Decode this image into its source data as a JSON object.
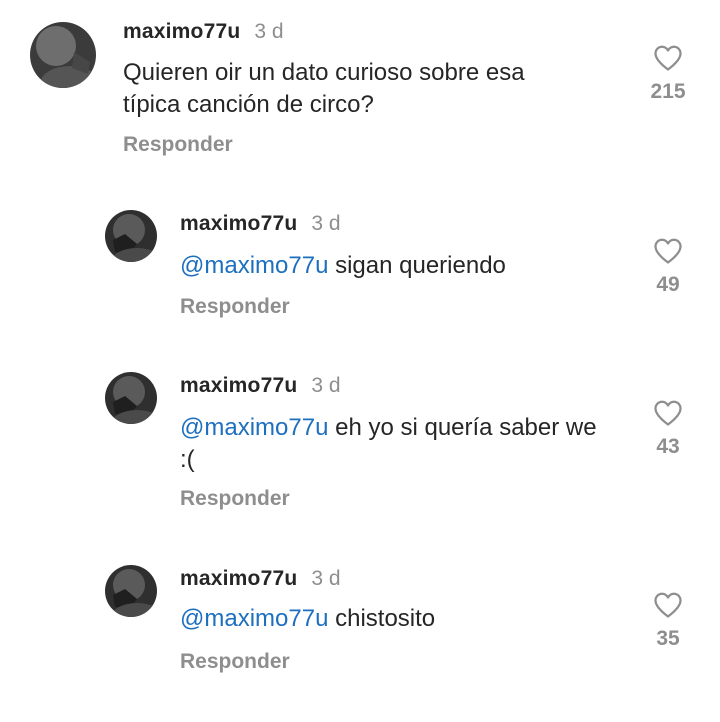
{
  "comments": [
    {
      "username": "maximo77u",
      "time": "3 d",
      "mention": "",
      "text": "Quieren oir un dato curioso sobre esa típica canción de circo?",
      "reply_label": "Responder",
      "likes": "215"
    },
    {
      "username": "maximo77u",
      "time": "3 d",
      "mention": "@maximo77u",
      "text": "sigan queriendo",
      "reply_label": "Responder",
      "likes": "49"
    },
    {
      "username": "maximo77u",
      "time": "3 d",
      "mention": "@maximo77u",
      "text": "eh yo si quería saber we :(",
      "reply_label": "Responder",
      "likes": "43"
    },
    {
      "username": "maximo77u",
      "time": "3 d",
      "mention": "@maximo77u",
      "text": "chistosito",
      "reply_label": "Responder",
      "likes": "35"
    }
  ],
  "icons": {
    "like": "heart-outline-icon"
  },
  "colors": {
    "mention": "#1d6fbf",
    "secondary_text": "#8e8e8e",
    "primary_text": "#262626"
  }
}
